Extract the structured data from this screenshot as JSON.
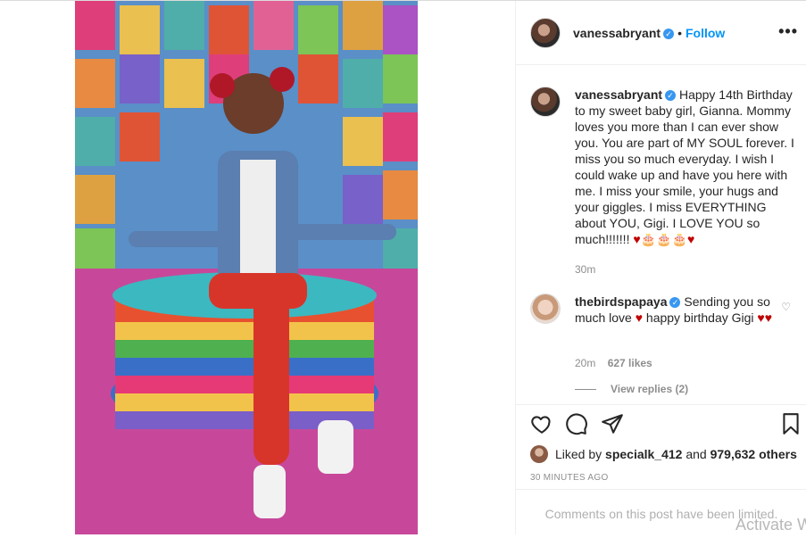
{
  "post": {
    "author": "vanessabryant",
    "follow_label": "Follow",
    "more_label": "•••",
    "photo_alt": ""
  },
  "caption": {
    "user": "vanessabryant",
    "text": "Happy 14th Birthday to my sweet baby girl, Gianna. Mommy loves you more than I can ever show you. You are part of MY SOUL forever. I miss you so much everyday. I wish I could wake up and have you here with me. I miss your smile, your hugs and your giggles. I miss EVERYTHING about YOU, Gigi. I LOVE YOU so much!!!!!!! ",
    "emoji": "♥🎂🎂🎂♥",
    "age": "30m"
  },
  "comment": {
    "user": "thebirdspapaya",
    "text": "Sending you so much love ",
    "text2": " happy birthday Gigi ",
    "hearts1": "♥",
    "hearts2": "♥♥",
    "age": "20m",
    "likes": "627 likes",
    "view_replies": "View replies (2)"
  },
  "likes": {
    "prefix": "Liked by ",
    "first_user": "specialk_412",
    "middle": " and ",
    "count": "979,632 others"
  },
  "timestamp": "30 MINUTES AGO",
  "comments_limited": "Comments on this post have been limited.",
  "watermark": "Activate W",
  "colors": {
    "accent": "#0095f6",
    "verified": "#3897f0",
    "heart": "#c00000"
  }
}
